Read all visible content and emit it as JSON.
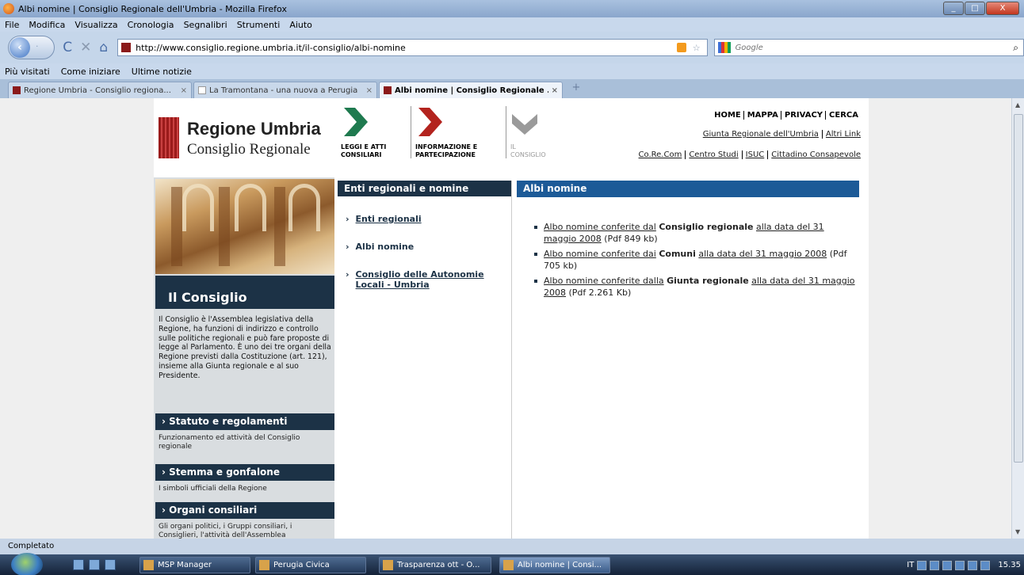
{
  "window": {
    "title": "Albi nomine | Consiglio Regionale dell'Umbria - Mozilla Firefox",
    "controls": [
      "_",
      "□",
      "X"
    ]
  },
  "menu": [
    "File",
    "Modifica",
    "Visualizza",
    "Cronologia",
    "Segnalibri",
    "Strumenti",
    "Aiuto"
  ],
  "nav": {
    "url": "http://www.consiglio.regione.umbria.it/il-consiglio/albi-nomine",
    "search_placeholder": "Google",
    "back": "‹",
    "forward": "·",
    "reload": "C",
    "stop": "✕",
    "home": "⌂",
    "star": "☆",
    "search_icon": "⌕"
  },
  "bookmarks": [
    "Più visitati",
    "Come iniziare",
    "Ultime notizie"
  ],
  "tabs": [
    {
      "label": "Regione Umbria - Consiglio regiona...",
      "close": "×"
    },
    {
      "label": "La Tramontana - una nuova a Perugia",
      "close": "×"
    },
    {
      "label": "Albi nomine | Consiglio Regionale ...",
      "close": "×"
    }
  ],
  "newtab": "+",
  "site": {
    "logo_line1": "Regione Umbria",
    "logo_line2": "Consiglio Regionale",
    "sections": [
      {
        "label_line1": "LEGGI E ATTI",
        "label_line2": "CONSILIARI",
        "color": "#1f7a4f"
      },
      {
        "label_line1": "INFORMAZIONE E",
        "label_line2": "PARTECIPAZIONE",
        "color": "#b3231e"
      },
      {
        "label_line1": "IL",
        "label_line2": "CONSIGLIO",
        "color": "#9a9a9a"
      }
    ],
    "toplinks": [
      "HOME",
      "MAPPA",
      "PRIVACY",
      "CERCA"
    ],
    "links2": [
      "Giunta Regionale dell'Umbria",
      "Altri Link"
    ],
    "links3": [
      "Co.Re.Com",
      "Centro Studi",
      "ISUC",
      "Cittadino Consapevole"
    ],
    "consiglio_title": "Il Consiglio",
    "consiglio_text": "Il Consiglio è l'Assemblea legislativa della Regione, ha funzioni di indirizzo e controllo sulle politiche regionali e può fare proposte di legge al Parlamento. È uno dei tre organi della Regione previsti dalla Costituzione (art. 121), insieme alla Giunta regionale e al suo Presidente.",
    "left_sections": [
      {
        "title": "Statuto e regolamenti",
        "desc": "Funzionamento ed attività del Consiglio regionale"
      },
      {
        "title": "Stemma e gonfalone",
        "desc": "I simboli ufficiali della Regione"
      },
      {
        "title": "Organi consiliari",
        "desc": "Gli organi politici, i Gruppi consiliari, i Consiglieri, l'attività dell'Assemblea"
      }
    ],
    "mid_header": "Enti regionali e nomine",
    "mid_links": [
      "Enti regionali",
      "Albi nomine",
      "Consiglio delle Autonomie Locali - Umbria"
    ],
    "right_header": "Albi nomine",
    "albi": [
      {
        "link": "Albo nomine conferite dal",
        "bold": "Consiglio regionale",
        "link2": "alla data del 31 maggio 2008",
        "size": "(Pdf 849 kb)"
      },
      {
        "link": "Albo nomine conferite dai",
        "bold": "Comuni",
        "link2": "alla data del 31 maggio 2008",
        "size": "(Pdf 705 kb)"
      },
      {
        "link": "Albo nomine conferite dalla",
        "bold": "Giunta regionale",
        "link2": "alla data del 31 maggio 2008",
        "size": "(Pdf 2.261 Kb)"
      }
    ]
  },
  "status": "Completato",
  "taskbar": {
    "tasks": [
      "MSP Manager",
      "Perugia Civica",
      "Trasparenza ott - O...",
      "Albi nomine | Consi..."
    ],
    "lang": "IT",
    "time": "15.35"
  }
}
